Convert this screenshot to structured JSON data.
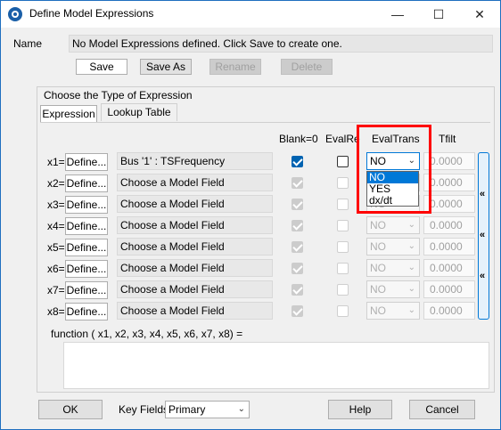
{
  "window": {
    "title": "Define Model Expressions",
    "controls": [
      "—",
      "☐",
      "✕"
    ]
  },
  "name": {
    "label": "Name",
    "value": "No Model Expressions defined.  Click Save to create one."
  },
  "name_buttons": {
    "save": "Save",
    "save_as": "Save As",
    "rename": "Rename",
    "delete": "Delete"
  },
  "expression_type": {
    "group_label": "Choose the Type of Expression",
    "tabs": [
      "Expression",
      "Lookup Table"
    ]
  },
  "columns": {
    "blank0": "Blank=0",
    "evalre": "EvalRe",
    "evaltrans": "EvalTrans",
    "tfilt": "Tfilt"
  },
  "rows": [
    {
      "label": "x1=",
      "define": "Define...",
      "field": "Bus '1' : TSFrequency",
      "blank0": true,
      "evalre": false,
      "evaltrans": "NO",
      "tfilt": "0.0000"
    },
    {
      "label": "x2=",
      "define": "Define...",
      "field": "Choose a Model Field",
      "blank0": true,
      "evalre": false,
      "evaltrans": "NO",
      "tfilt": "0.0000"
    },
    {
      "label": "x3=",
      "define": "Define...",
      "field": "Choose a Model Field",
      "blank0": true,
      "evalre": false,
      "evaltrans": "NO",
      "tfilt": "0.0000"
    },
    {
      "label": "x4=",
      "define": "Define...",
      "field": "Choose a Model Field",
      "blank0": true,
      "evalre": false,
      "evaltrans": "NO",
      "tfilt": "0.0000"
    },
    {
      "label": "x5=",
      "define": "Define...",
      "field": "Choose a Model Field",
      "blank0": true,
      "evalre": false,
      "evaltrans": "NO",
      "tfilt": "0.0000"
    },
    {
      "label": "x6=",
      "define": "Define...",
      "field": "Choose a Model Field",
      "blank0": true,
      "evalre": false,
      "evaltrans": "NO",
      "tfilt": "0.0000"
    },
    {
      "label": "x7=",
      "define": "Define...",
      "field": "Choose a Model Field",
      "blank0": true,
      "evalre": false,
      "evaltrans": "NO",
      "tfilt": "0.0000"
    },
    {
      "label": "x8=",
      "define": "Define...",
      "field": "Choose a Model Field",
      "blank0": true,
      "evalre": false,
      "evaltrans": "NO",
      "tfilt": "0.0000"
    }
  ],
  "evaltrans_dropdown": {
    "options": [
      "NO",
      "YES",
      "dx/dt"
    ],
    "selected": "NO"
  },
  "side_buttons": [
    "«",
    "«",
    "«"
  ],
  "function": {
    "label": "function ( x1, x2, x3, x4, x5, x6, x7, x8) =",
    "value": ""
  },
  "footer": {
    "ok": "OK",
    "key_fields_label": "Key Fields",
    "key_fields_value": "Primary",
    "help": "Help",
    "cancel": "Cancel"
  },
  "colors": {
    "highlight_box": "#ff0000",
    "accent": "#0078d7",
    "checked": "#0063b1"
  },
  "icons": {
    "app": "app-logo-icon",
    "dropdown": "chevron-down-icon",
    "collapse": "double-chevron-left-icon"
  }
}
